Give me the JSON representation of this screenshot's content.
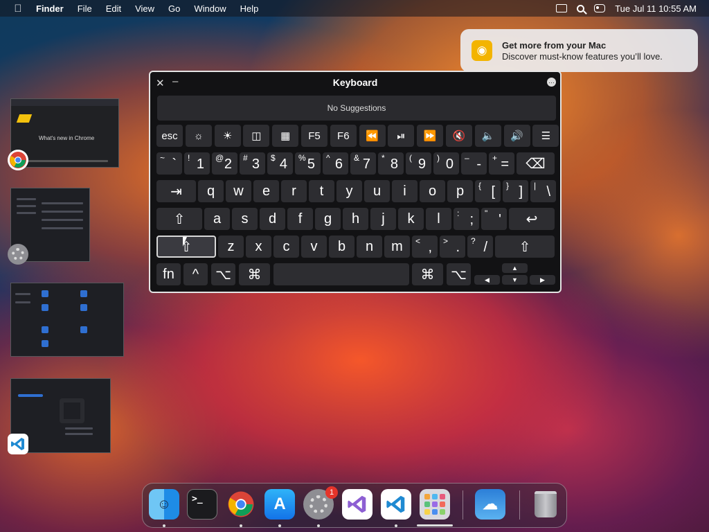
{
  "menubar": {
    "app_name": "Finder",
    "items": [
      "File",
      "Edit",
      "View",
      "Go",
      "Window",
      "Help"
    ],
    "datetime": "Tue Jul 11  10:55 AM"
  },
  "notification": {
    "title": "Get more from your Mac",
    "body": "Discover must-know features you’ll love."
  },
  "thumbnails": {
    "chrome_caption": "What's new in Chrome"
  },
  "keyboard": {
    "title": "Keyboard",
    "suggestions": "No Suggestions",
    "row1": [
      "esc",
      "☼",
      "☀",
      "◫",
      "▦",
      "F5",
      "F6",
      "⏪",
      "⏯",
      "⏩",
      "🔇",
      "🔈",
      "🔊",
      "☰"
    ],
    "row2": [
      {
        "sub": "~",
        "main": "`"
      },
      {
        "sub": "!",
        "main": "1"
      },
      {
        "sub": "@",
        "main": "2"
      },
      {
        "sub": "#",
        "main": "3"
      },
      {
        "sub": "$",
        "main": "4"
      },
      {
        "sub": "%",
        "main": "5"
      },
      {
        "sub": "^",
        "main": "6"
      },
      {
        "sub": "&",
        "main": "7"
      },
      {
        "sub": "*",
        "main": "8"
      },
      {
        "sub": "(",
        "main": "9"
      },
      {
        "sub": ")",
        "main": "0"
      },
      {
        "sub": "–",
        "main": "-"
      },
      {
        "sub": "+",
        "main": "="
      }
    ],
    "row3_letters": [
      "q",
      "w",
      "e",
      "r",
      "t",
      "y",
      "u",
      "i",
      "o",
      "p"
    ],
    "row3_symbols": [
      {
        "sub": "{",
        "main": "["
      },
      {
        "sub": "}",
        "main": "]"
      },
      {
        "sub": "|",
        "main": "\\"
      }
    ],
    "row4_letters": [
      "a",
      "s",
      "d",
      "f",
      "g",
      "h",
      "j",
      "k",
      "l"
    ],
    "row4_symbols": [
      {
        "sub": ":",
        "main": ";"
      },
      {
        "sub": "\"",
        "main": "'"
      }
    ],
    "row5_letters": [
      "z",
      "x",
      "c",
      "v",
      "b",
      "n",
      "m"
    ],
    "row5_symbols": [
      {
        "sub": "<",
        "main": ","
      },
      {
        "sub": ">",
        "main": "."
      },
      {
        "sub": "?",
        "main": "/"
      }
    ],
    "row6": {
      "fn": "fn",
      "ctrl": "^",
      "opt": "⌥",
      "cmd": "⌘"
    },
    "special": {
      "tab": "⇥",
      "delete": "⌫",
      "shift": "⇧",
      "return": "↩"
    },
    "arrows": {
      "up": "▲",
      "left": "◀",
      "down": "▼",
      "right": "▶"
    }
  },
  "dock": {
    "badge_count": "1",
    "terminal_prompt": ">_"
  }
}
